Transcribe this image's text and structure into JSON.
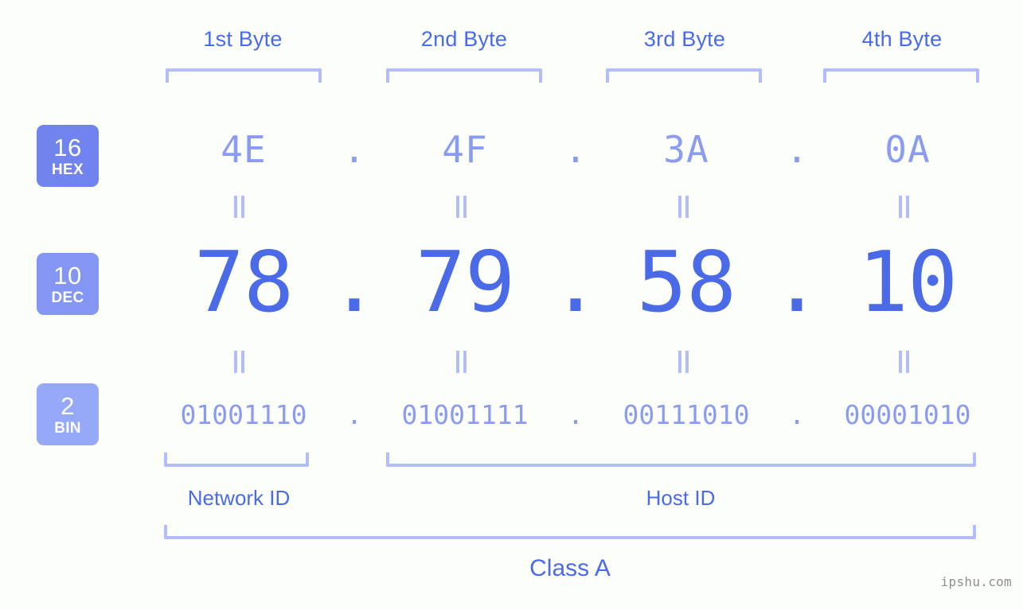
{
  "background_color": "#fcfefa",
  "accent_color": "#4a6ae8",
  "accent_light_color": "#8a9bf0",
  "bracket_color": "#b3bdfb",
  "header": {
    "byte_labels": [
      {
        "label": "1st Byte"
      },
      {
        "label": "2nd Byte"
      },
      {
        "label": "3rd Byte"
      },
      {
        "label": "4th Byte"
      }
    ]
  },
  "bases": [
    {
      "number": "16",
      "name": "HEX",
      "color": "#7083ef"
    },
    {
      "number": "10",
      "name": "DEC",
      "color": "#8396f4"
    },
    {
      "number": "2",
      "name": "BIN",
      "color": "#96a9f9"
    }
  ],
  "separator": {
    "glyph": "="
  },
  "rows": {
    "hex": {
      "base_number": "16",
      "base_name": "HEX",
      "values": [
        "4E",
        "4F",
        "3A",
        "0A"
      ],
      "delimiter": "."
    },
    "dec": {
      "base_number": "10",
      "base_name": "DEC",
      "values": [
        "78",
        "79",
        "58",
        "10"
      ],
      "delimiter": "."
    },
    "bin": {
      "base_number": "2",
      "base_name": "BIN",
      "values": [
        "01001110",
        "01001111",
        "00111010",
        "00001010"
      ],
      "delimiter": "."
    }
  },
  "footer": {
    "network_id_label": "Network ID",
    "host_id_label": "Host ID",
    "class_label": "Class A"
  },
  "watermark": "ipshu.com"
}
